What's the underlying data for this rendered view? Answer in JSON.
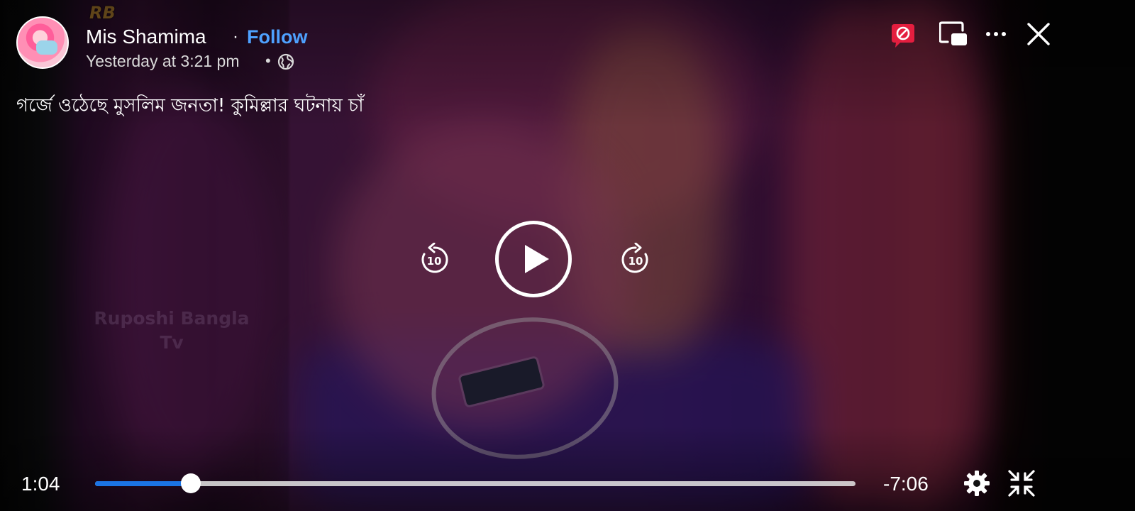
{
  "post": {
    "author_name": "Mis Shamima",
    "follow_label": "Follow",
    "timestamp": "Yesterday at 3:21 pm",
    "separator": "•",
    "name_separator": "·",
    "audience_icon": "globe-icon",
    "caption": "গর্জে ওঠেছে মুসলিম জনতা! কুমিল্লার ঘটনায় চাঁ"
  },
  "video": {
    "watermark_text": "Ruposhi Bangla Tv",
    "logo_text": "RB"
  },
  "top_controls": {
    "icons": [
      "reactions-off-icon",
      "picture-in-picture-icon",
      "more-options-icon",
      "close-icon"
    ],
    "accent_color": "#e41e3f"
  },
  "playback": {
    "rewind_seconds": "10",
    "forward_seconds": "10",
    "state": "paused",
    "elapsed": "1:04",
    "remaining": "-7:06",
    "progress_fraction": 0.126,
    "progress_color": "#1b74e4"
  },
  "bottom_controls": {
    "icons": [
      "settings-gear-icon",
      "exit-fullscreen-icon"
    ]
  }
}
